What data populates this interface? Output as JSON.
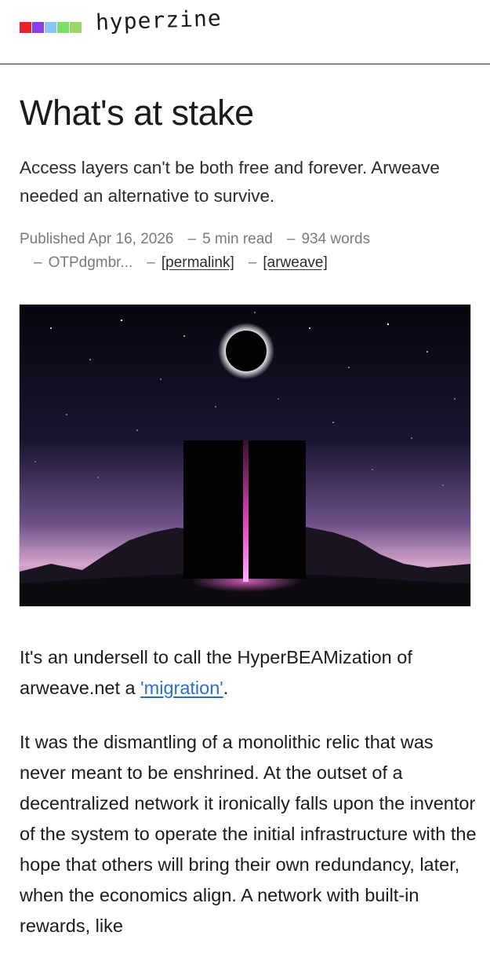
{
  "header": {
    "brand": "hyperzine",
    "logo_colors": [
      "#e8232e",
      "#8b3fe8",
      "#86c6f0",
      "#7be06a",
      "#9ad86a"
    ]
  },
  "article": {
    "title": "What's at stake",
    "subtitle": "Access layers can't be both free and forever. Arweave needed an alternative to survive.",
    "meta": {
      "published": "Published Apr 16, 2026",
      "read_time": "5 min read",
      "words": "934 words",
      "author": "OTPdgmbr...",
      "permalink_label": "[permalink]",
      "arweave_label": "[arweave]"
    },
    "hero_image": "eclipse-monolith-illustration",
    "paragraph1": {
      "before": "It's an undersell to call the HyperBEAMization of arweave.net a ",
      "link": "'migration'",
      "after": "."
    },
    "paragraph2": "It was the dismantling of a monolithic relic that was never meant to be enshrined. At the outset of a decentralized network it ironically falls upon the inventor of the system to operate the initial infrastructure with the hope that others will bring their own redundancy, later, when the economics align. A network with built-in rewards, like"
  },
  "colors": {
    "link": "#2a6fc5",
    "meta_text": "#7a7a7a",
    "beam": "#ff4fd0"
  }
}
